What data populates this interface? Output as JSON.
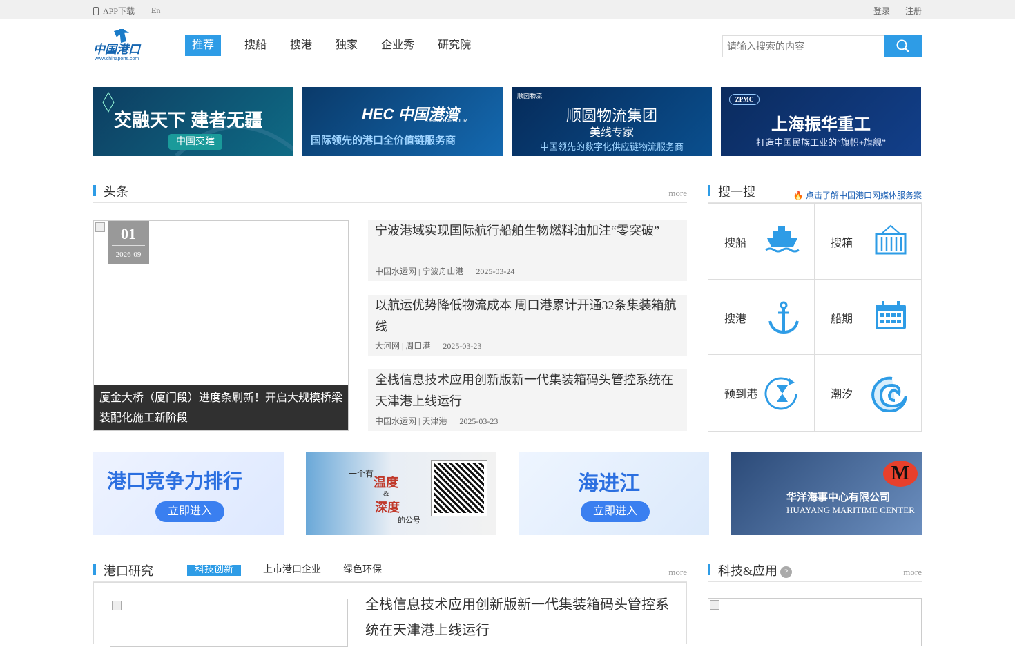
{
  "topbar": {
    "app_download": "APP下载",
    "lang": "En",
    "login": "登录",
    "register": "注册"
  },
  "logo": {
    "cn": "中国港口",
    "url": "www.chinaports.com"
  },
  "nav": [
    "推荐",
    "搜船",
    "搜港",
    "独家",
    "企业秀",
    "研究院"
  ],
  "search": {
    "placeholder": "请输入搜索的内容"
  },
  "banners": [
    {
      "line1": "交融天下 建者无疆",
      "button": "中国交建"
    },
    {
      "logo": "HEC 中国港湾",
      "logo_en": "CHINA HARBOUR",
      "line1": "国际领先的港口全价值链服务商"
    },
    {
      "brand": "顺圆物流",
      "line1": "顺圆物流集团",
      "line2": "美线专家",
      "line3": "中国领先的数字化供应链物流服务商"
    },
    {
      "brand": "ZPMC",
      "line1": "上海振华重工",
      "line2": "打造中国民族工业的“旗帜+旗舰”"
    }
  ],
  "headlines": {
    "title": "头条",
    "more": "more",
    "feature": {
      "day": "01",
      "month": "2026-09",
      "caption": "厦金大桥（厦门段）进度条刷新！开启大规模桥梁装配化施工新阶段"
    },
    "items": [
      {
        "title": "宁波港域实现国际航行船舶生物燃料油加注“零突破”",
        "source": "中国水运网 | 宁波舟山港",
        "date": "2025-03-24"
      },
      {
        "title": "以航运优势降低物流成本 周口港累计开通32条集装箱航线",
        "source": "大河网 | 周口港",
        "date": "2025-03-23"
      },
      {
        "title": "全栈信息技术应用创新版新一代集装箱码头管控系统在天津港上线运行",
        "source": "中国水运网 | 天津港",
        "date": "2025-03-23"
      }
    ]
  },
  "search_panel": {
    "title": "搜一搜",
    "promo": "点击了解中国港口网媒体服务案",
    "items": [
      {
        "label": "搜船",
        "icon": "ship-icon"
      },
      {
        "label": "搜箱",
        "icon": "container-icon"
      },
      {
        "label": "搜港",
        "icon": "anchor-icon"
      },
      {
        "label": "船期",
        "icon": "calendar-icon"
      },
      {
        "label": "预到港",
        "icon": "hourglass-icon"
      },
      {
        "label": "潮汐",
        "icon": "wave-icon"
      }
    ]
  },
  "ads": [
    {
      "text": "港口竞争力排行",
      "button": "立即进入"
    },
    {
      "text1": "一个有",
      "text2": "温度",
      "text3": "&",
      "text4": "深度",
      "text5": "的公号"
    },
    {
      "text": "海进江",
      "button": "立即进入"
    },
    {
      "line1": "华洋海事中心有限公司",
      "line2": "HUAYANG MARITIME CENTER",
      "logo": "M"
    }
  ],
  "research": {
    "title": "港口研究",
    "more": "more",
    "tabs": [
      "科技创新",
      "上市港口企业",
      "绿色环保"
    ],
    "article": "全栈信息技术应用创新版新一代集装箱码头管控系统在天津港上线运行"
  },
  "tech": {
    "title": "科技&应用",
    "help": "?",
    "more": "more"
  },
  "colors": {
    "accent": "#2e9ce6",
    "dark_banner": "#0b3a6e",
    "hot": "#e8382c"
  }
}
